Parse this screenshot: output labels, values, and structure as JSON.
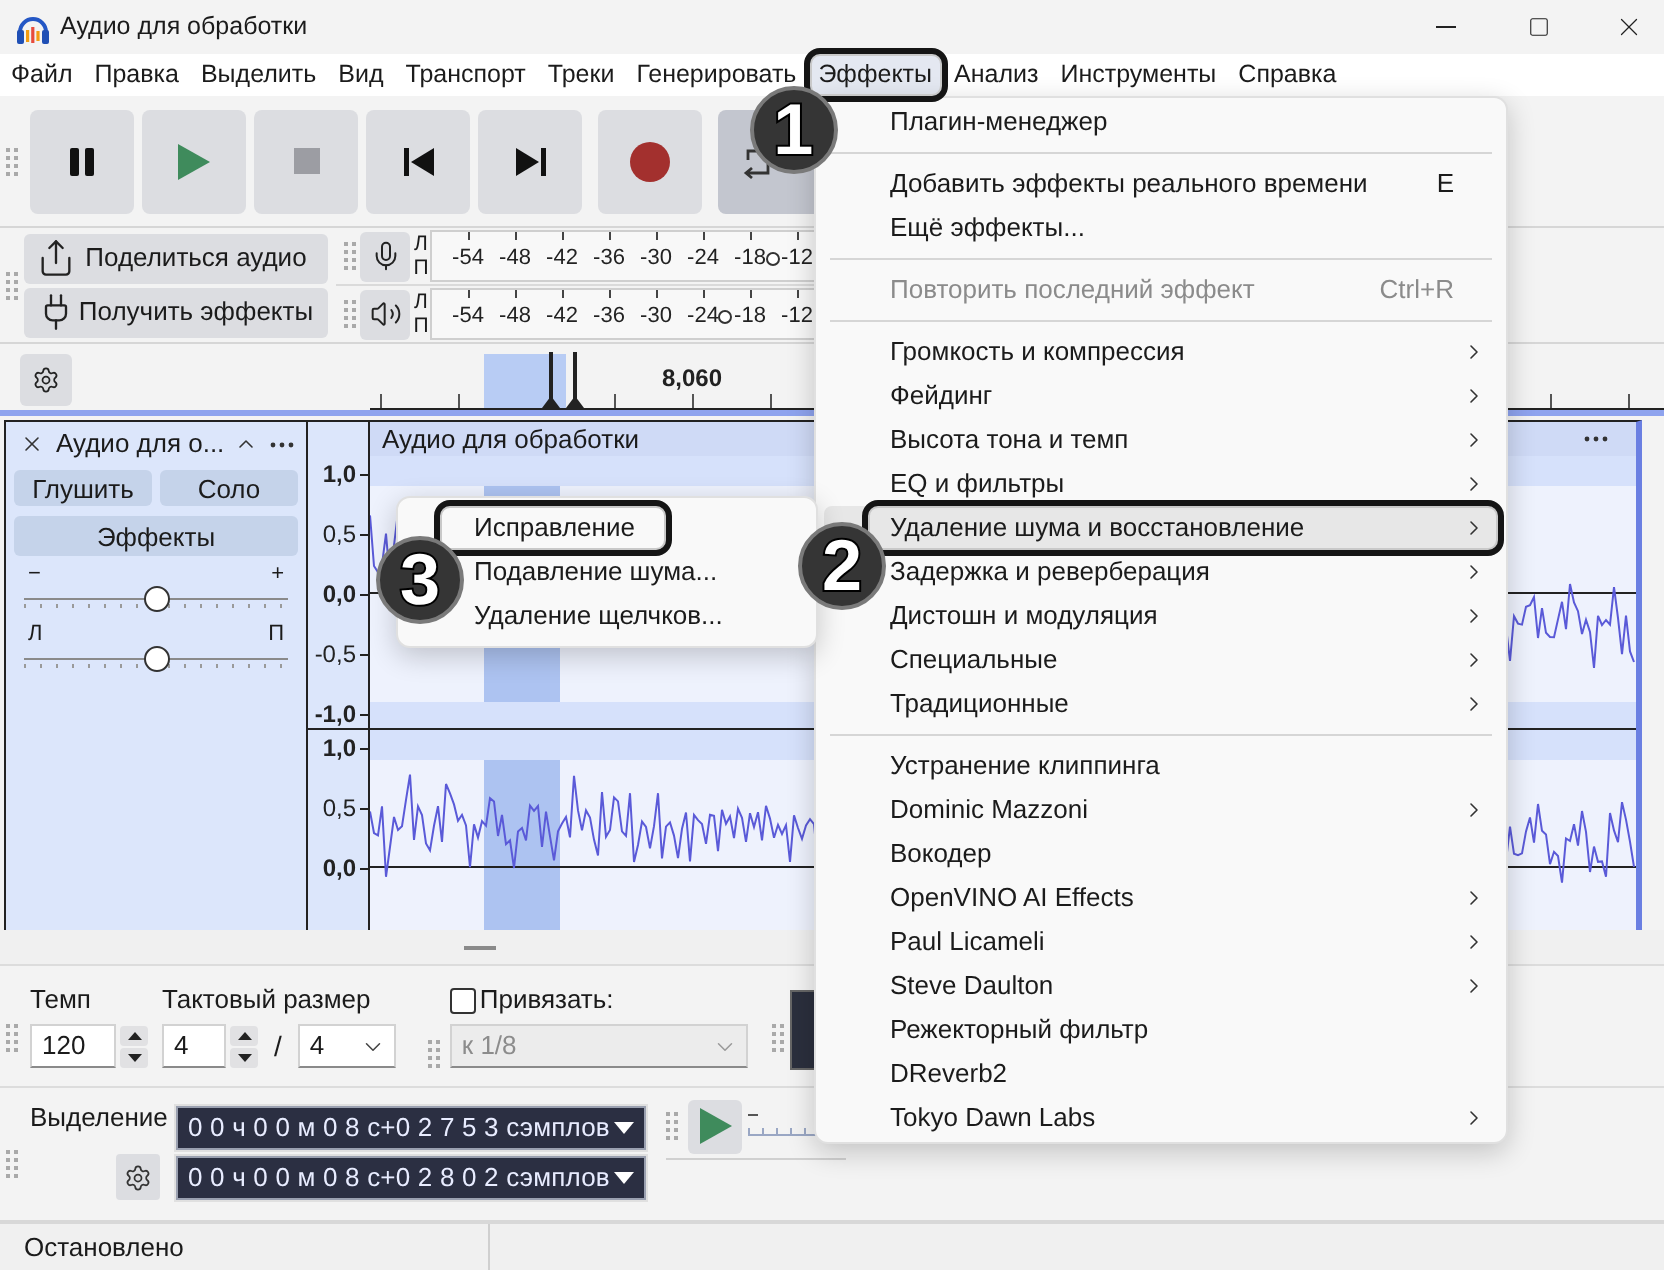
{
  "window": {
    "title": "Аудио для обработки"
  },
  "menu_bar": [
    {
      "label": "Файл",
      "selected": false
    },
    {
      "label": "Правка",
      "selected": false
    },
    {
      "label": "Выделить",
      "selected": false
    },
    {
      "label": "Вид",
      "selected": false
    },
    {
      "label": "Транспорт",
      "selected": false
    },
    {
      "label": "Треки",
      "selected": false
    },
    {
      "label": "Генерировать",
      "selected": false
    },
    {
      "label": "Эффекты",
      "selected": true,
      "callout": "1"
    },
    {
      "label": "Анализ",
      "selected": false
    },
    {
      "label": "Инструменты",
      "selected": false
    },
    {
      "label": "Справка",
      "selected": false
    }
  ],
  "transport": [
    {
      "kind": "pause",
      "disabled": false,
      "on": false
    },
    {
      "kind": "play",
      "disabled": false,
      "on": false
    },
    {
      "kind": "stop",
      "disabled": true,
      "on": false
    },
    {
      "kind": "skip_start",
      "disabled": false,
      "on": false
    },
    {
      "kind": "skip_end",
      "disabled": false,
      "on": false
    },
    {
      "kind": "record",
      "disabled": false,
      "on": false
    },
    {
      "kind": "loop",
      "disabled": false,
      "on": true
    }
  ],
  "share_tools": [
    {
      "kind": "share",
      "label": "Поделиться аудио"
    },
    {
      "kind": "plug",
      "label": "Получить эффекты"
    }
  ],
  "meters": [
    {
      "kind": "microphone",
      "channels": [
        "Л",
        "П"
      ],
      "scale": [
        "-54",
        "-48",
        "-42",
        "-36",
        "-30",
        "-24",
        "-18",
        "-12"
      ],
      "level": 0.86
    },
    {
      "kind": "speaker",
      "channels": [
        "Л",
        "П"
      ],
      "scale": [
        "-54",
        "-48",
        "-42",
        "-36",
        "-30",
        "-24",
        "-18",
        "-12"
      ],
      "level": 0.74
    }
  ],
  "timeline": {
    "label": "8,060"
  },
  "track": {
    "name": "Аудио для о...",
    "buttons": [
      "Глушить",
      "Соло"
    ],
    "effects_button": "Эффекты",
    "gain": {
      "min_label": "−",
      "max_label": "+",
      "level": 0.5
    },
    "pan": {
      "min_label": "Л",
      "max_label": "П",
      "level": 0.5
    },
    "clip_title": "Аудио для обработки",
    "channels": [
      {
        "scale": [
          {
            "label": "1,0",
            "major": true
          },
          {
            "label": "0,5",
            "major": false
          },
          {
            "label": "0,0",
            "major": true
          },
          {
            "label": "-0,5",
            "major": false
          },
          {
            "label": "-1,0",
            "major": true
          }
        ]
      },
      {
        "scale": [
          {
            "label": "1,0",
            "major": true
          },
          {
            "label": "0,5",
            "major": false
          },
          {
            "label": "0,0",
            "major": true
          }
        ]
      }
    ]
  },
  "tempo": {
    "label": "Темп",
    "value": "120"
  },
  "time_signature": {
    "label": "Тактовый размер",
    "beats": "4",
    "separator": "/",
    "note_value": "4"
  },
  "snap": {
    "label": "Привязать:",
    "checked": false,
    "value": "к 1/8",
    "disabled": true
  },
  "selection": {
    "label": "Выделение",
    "start": "0 0 ч 0 0 м 0 8 с+0 2 7 5 3 сэмплов",
    "end": "0 0 ч 0 0 м 0 8 с+0 2 8 0 2 сэмплов"
  },
  "status_bar": {
    "text": "Остановлено"
  },
  "effects_menu": {
    "sections": [
      {
        "items": [
          {
            "label": "Плагин-менеджер",
            "selected": false,
            "disabled": false,
            "submenu": false
          }
        ]
      },
      {
        "items": [
          {
            "label": "Добавить эффекты реального времени",
            "shortcut": "E",
            "selected": false,
            "disabled": false,
            "submenu": false
          },
          {
            "label": "Ещё эффекты...",
            "selected": false,
            "disabled": false,
            "submenu": false
          }
        ]
      },
      {
        "items": [
          {
            "label": "Повторить последний эффект",
            "shortcut": "Ctrl+R",
            "selected": false,
            "disabled": true,
            "submenu": false
          }
        ]
      },
      {
        "items": [
          {
            "label": "Громкость и компрессия",
            "selected": false,
            "disabled": false,
            "submenu": true
          },
          {
            "label": "Фейдинг",
            "selected": false,
            "disabled": false,
            "submenu": true
          },
          {
            "label": "Высота тона и темп",
            "selected": false,
            "disabled": false,
            "submenu": true
          },
          {
            "label": "EQ и фильтры",
            "selected": false,
            "disabled": false,
            "submenu": true
          },
          {
            "label": "Удаление шума и восстановление",
            "selected": true,
            "disabled": false,
            "submenu": true,
            "callout": "2",
            "submenu_items": [
              {
                "label": "Исправление",
                "selected": false,
                "callout": "3"
              },
              {
                "label": "Подавление шума...",
                "selected": false
              },
              {
                "label": "Удаление щелчков...",
                "selected": false
              }
            ]
          },
          {
            "label": "Задержка и реверберация",
            "selected": false,
            "disabled": false,
            "submenu": true
          },
          {
            "label": "Дистошн и модуляция",
            "selected": false,
            "disabled": false,
            "submenu": true
          },
          {
            "label": "Специальные",
            "selected": false,
            "disabled": false,
            "submenu": true
          },
          {
            "label": "Традиционные",
            "selected": false,
            "disabled": false,
            "submenu": true
          }
        ]
      },
      {
        "items": [
          {
            "label": "Устранение клиппинга",
            "selected": false,
            "disabled": false,
            "submenu": false
          },
          {
            "label": "Dominic Mazzoni",
            "selected": false,
            "disabled": false,
            "submenu": true
          },
          {
            "label": "Вокодер",
            "selected": false,
            "disabled": false,
            "submenu": false
          },
          {
            "label": "OpenVINO AI Effects",
            "selected": false,
            "disabled": false,
            "submenu": true
          },
          {
            "label": "Paul Licameli",
            "selected": false,
            "disabled": false,
            "submenu": true
          },
          {
            "label": "Steve Daulton",
            "selected": false,
            "disabled": false,
            "submenu": true
          },
          {
            "label": "Режекторный фильтр",
            "selected": false,
            "disabled": false,
            "submenu": false
          },
          {
            "label": "DReverb2",
            "selected": false,
            "disabled": false,
            "submenu": false
          },
          {
            "label": "Tokyo Dawn Labs",
            "selected": false,
            "disabled": false,
            "submenu": true
          }
        ]
      }
    ]
  }
}
